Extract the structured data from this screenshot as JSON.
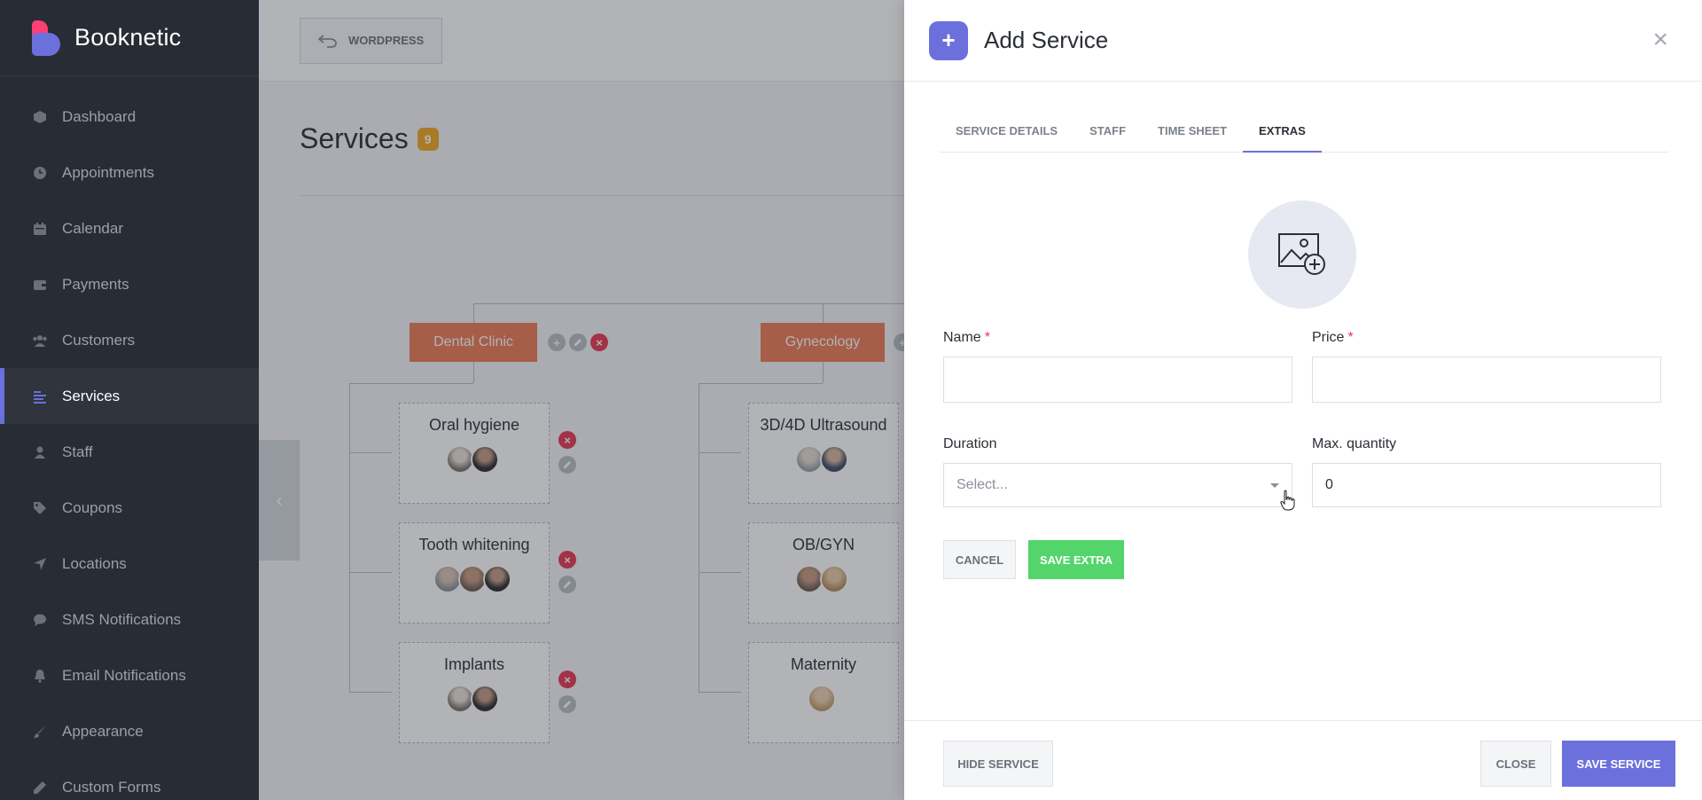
{
  "app": {
    "name": "Booknetic"
  },
  "colors": {
    "accent": "#6c70dc",
    "brand_pink": "#ff3e73",
    "sidebar_bg": "#282c34",
    "save_green": "#53d56c",
    "category_orange": "#ee7a55",
    "delete_red": "#e8364f",
    "badge_orange": "#f6a623"
  },
  "sidebar": {
    "items": [
      {
        "label": "Dashboard",
        "icon": "cube-icon"
      },
      {
        "label": "Appointments",
        "icon": "clock-icon"
      },
      {
        "label": "Calendar",
        "icon": "calendar-icon"
      },
      {
        "label": "Payments",
        "icon": "wallet-icon"
      },
      {
        "label": "Customers",
        "icon": "users-icon"
      },
      {
        "label": "Services",
        "icon": "list-icon",
        "active": true
      },
      {
        "label": "Staff",
        "icon": "user-icon"
      },
      {
        "label": "Coupons",
        "icon": "tag-icon"
      },
      {
        "label": "Locations",
        "icon": "location-arrow-icon"
      },
      {
        "label": "SMS Notifications",
        "icon": "chat-icon"
      },
      {
        "label": "Email Notifications",
        "icon": "bell-icon"
      },
      {
        "label": "Appearance",
        "icon": "brush-icon"
      },
      {
        "label": "Custom Forms",
        "icon": "pencil-icon"
      }
    ]
  },
  "topbar": {
    "wordpress_label": "WORDPRESS"
  },
  "page": {
    "title": "Services",
    "count": "9"
  },
  "categories": [
    {
      "name": "Dental Clinic",
      "services": [
        {
          "name": "Oral hygiene"
        },
        {
          "name": "Tooth whitening"
        },
        {
          "name": "Implants"
        }
      ]
    },
    {
      "name": "Gynecology",
      "services": [
        {
          "name": "3D/4D Ultrasound"
        },
        {
          "name": "OB/GYN"
        },
        {
          "name": "Maternity"
        }
      ]
    }
  ],
  "panel": {
    "title": "Add Service",
    "tabs": [
      "SERVICE DETAILS",
      "STAFF",
      "TIME SHEET",
      "EXTRAS"
    ],
    "active_tab": "EXTRAS",
    "form": {
      "name_label": "Name",
      "name_value": "",
      "price_label": "Price",
      "price_value": "",
      "required_mark": "*",
      "duration_label": "Duration",
      "duration_placeholder": "Select...",
      "max_quantity_label": "Max. quantity",
      "max_quantity_value": "0"
    },
    "buttons": {
      "cancel": "CANCEL",
      "save_extra": "SAVE EXTRA",
      "hide_service": "HIDE SERVICE",
      "close": "CLOSE",
      "save_service": "SAVE SERVICE"
    }
  }
}
